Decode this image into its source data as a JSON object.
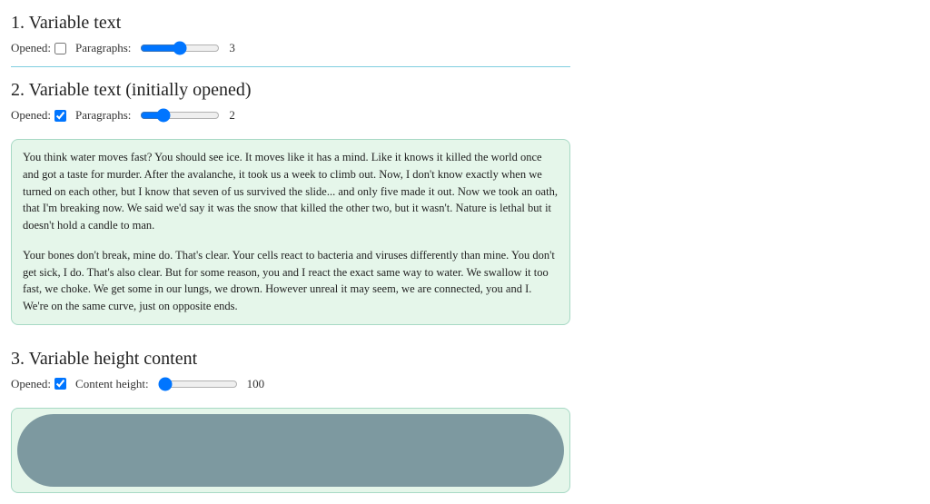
{
  "section1": {
    "title": "1. Variable text",
    "opened_label": "Opened:",
    "opened": false,
    "paragraphs_label": "Paragraphs:",
    "paragraphs": 3
  },
  "section2": {
    "title": "2. Variable text (initially opened)",
    "opened_label": "Opened:",
    "opened": true,
    "paragraphs_label": "Paragraphs:",
    "paragraphs": 2,
    "paragraphs_text": [
      "You think water moves fast? You should see ice. It moves like it has a mind. Like it knows it killed the world once and got a taste for murder. After the avalanche, it took us a week to climb out. Now, I don't know exactly when we turned on each other, but I know that seven of us survived the slide... and only five made it out. Now we took an oath, that I'm breaking now. We said we'd say it was the snow that killed the other two, but it wasn't. Nature is lethal but it doesn't hold a candle to man.",
      "Your bones don't break, mine do. That's clear. Your cells react to bacteria and viruses differently than mine. You don't get sick, I do. That's also clear. But for some reason, you and I react the exact same way to water. We swallow it too fast, we choke. We get some in our lungs, we drown. However unreal it may seem, we are connected, you and I. We're on the same curve, just on opposite ends."
    ]
  },
  "section3": {
    "title": "3. Variable height content",
    "opened_label": "Opened:",
    "opened": true,
    "height_label": "Content height:",
    "height": 100,
    "height_min": 100,
    "height_max": 1000
  }
}
